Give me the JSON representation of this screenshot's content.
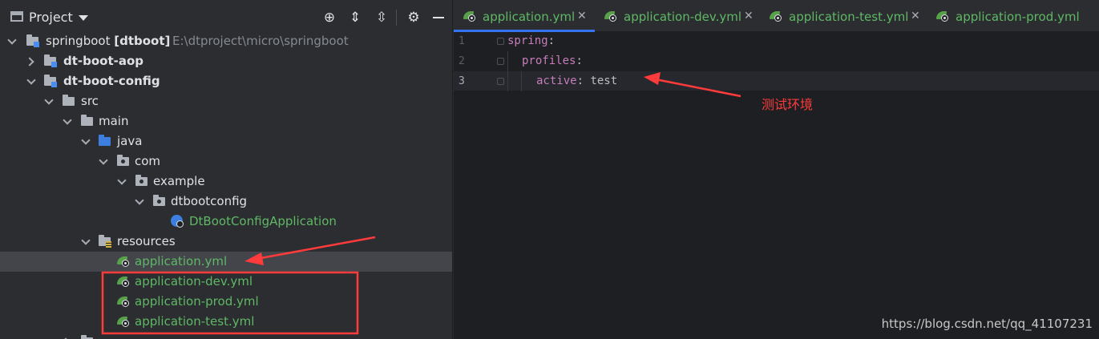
{
  "panel": {
    "title": "Project"
  },
  "tree": {
    "root": {
      "name": "springboot [dtboot]",
      "path": "E:\\dtproject\\micro\\springboot"
    },
    "aop": "dt-boot-aop",
    "config": "dt-boot-config",
    "src": "src",
    "main": "main",
    "java": "java",
    "com": "com",
    "example": "example",
    "dtbootconfig": "dtbootconfig",
    "app_class": "DtBootConfigApplication",
    "resources": "resources",
    "files": [
      "application.yml",
      "application-dev.yml",
      "application-prod.yml",
      "application-test.yml"
    ]
  },
  "tabs": [
    {
      "label": "application.yml",
      "active": true
    },
    {
      "label": "application-dev.yml",
      "active": false
    },
    {
      "label": "application-test.yml",
      "active": false
    },
    {
      "label": "application-prod.yml",
      "active": false
    }
  ],
  "editor": {
    "line_numbers": [
      "1",
      "2",
      "3"
    ],
    "lines": [
      {
        "key": "spring",
        "punct": ":",
        "value": ""
      },
      {
        "key": "profiles",
        "punct": ":",
        "value": ""
      },
      {
        "key": "active",
        "punct": ": ",
        "value": "test"
      }
    ]
  },
  "annotations": {
    "env_label": "测试环境",
    "watermark": "https://blog.csdn.net/qq_41107231"
  },
  "colors": {
    "annotation": "#ff3b3b",
    "yaml_key": "#c77dbb",
    "spring_file": "#5fb865"
  }
}
